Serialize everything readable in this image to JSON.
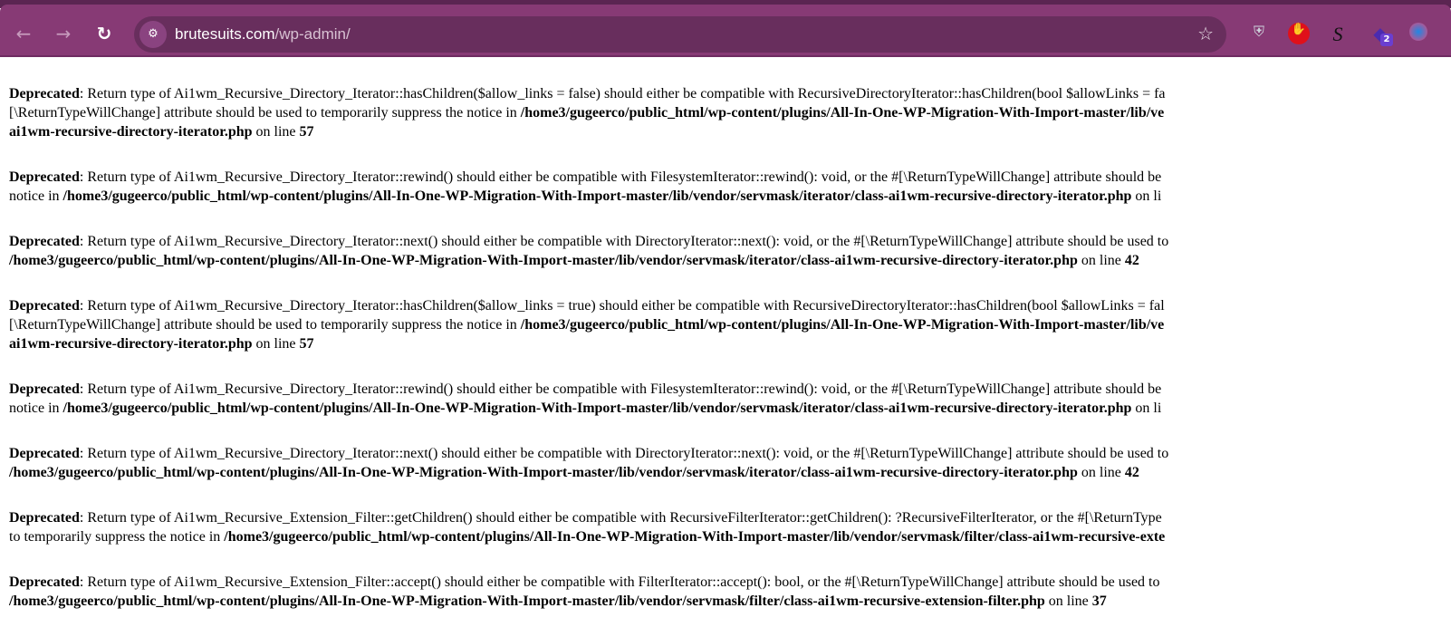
{
  "browser": {
    "url_domain": "brutesuits.com",
    "url_path": "/wp-admin/",
    "extensions": [
      {
        "icon": "shield-extension-icon"
      },
      {
        "icon": "adblock-hand-icon"
      },
      {
        "icon": "s-letter-extension-icon",
        "label": "S"
      },
      {
        "icon": "stack-extension-icon",
        "badge": "2"
      },
      {
        "icon": "browser-extension-icon"
      }
    ]
  },
  "notices": [
    [
      [
        [
          "Deprecated",
          true
        ],
        [
          ": Return type of Ai1wm_Recursive_Directory_Iterator::hasChildren($allow_links = false) should either be compatible with RecursiveDirectoryIterator::hasChildren(bool $allowLinks = fa",
          false
        ]
      ],
      [
        [
          "[\\ReturnTypeWillChange] attribute should be used to temporarily suppress the notice in ",
          false
        ],
        [
          "/home3/gugeerco/public_html/wp-content/plugins/All-In-One-WP-Migration-With-Import-master/lib/ve",
          true
        ]
      ],
      [
        [
          "ai1wm-recursive-directory-iterator.php",
          true
        ],
        [
          " on line ",
          false
        ],
        [
          "57",
          true
        ]
      ]
    ],
    [
      [
        [
          "Deprecated",
          true
        ],
        [
          ": Return type of Ai1wm_Recursive_Directory_Iterator::rewind() should either be compatible with FilesystemIterator::rewind(): void, or the #[\\ReturnTypeWillChange] attribute should be",
          false
        ]
      ],
      [
        [
          "notice in ",
          false
        ],
        [
          "/home3/gugeerco/public_html/wp-content/plugins/All-In-One-WP-Migration-With-Import-master/lib/vendor/servmask/iterator/class-ai1wm-recursive-directory-iterator.php",
          true
        ],
        [
          " on li",
          false
        ]
      ]
    ],
    [
      [
        [
          "Deprecated",
          true
        ],
        [
          ": Return type of Ai1wm_Recursive_Directory_Iterator::next() should either be compatible with DirectoryIterator::next(): void, or the #[\\ReturnTypeWillChange] attribute should be used to",
          false
        ]
      ],
      [
        [
          "/home3/gugeerco/public_html/wp-content/plugins/All-In-One-WP-Migration-With-Import-master/lib/vendor/servmask/iterator/class-ai1wm-recursive-directory-iterator.php",
          true
        ],
        [
          " on line ",
          false
        ],
        [
          "42",
          true
        ]
      ]
    ],
    [
      [
        [
          "Deprecated",
          true
        ],
        [
          ": Return type of Ai1wm_Recursive_Directory_Iterator::hasChildren($allow_links = true) should either be compatible with RecursiveDirectoryIterator::hasChildren(bool $allowLinks = fal",
          false
        ]
      ],
      [
        [
          "[\\ReturnTypeWillChange] attribute should be used to temporarily suppress the notice in ",
          false
        ],
        [
          "/home3/gugeerco/public_html/wp-content/plugins/All-In-One-WP-Migration-With-Import-master/lib/ve",
          true
        ]
      ],
      [
        [
          "ai1wm-recursive-directory-iterator.php",
          true
        ],
        [
          " on line ",
          false
        ],
        [
          "57",
          true
        ]
      ]
    ],
    [
      [
        [
          "Deprecated",
          true
        ],
        [
          ": Return type of Ai1wm_Recursive_Directory_Iterator::rewind() should either be compatible with FilesystemIterator::rewind(): void, or the #[\\ReturnTypeWillChange] attribute should be",
          false
        ]
      ],
      [
        [
          "notice in ",
          false
        ],
        [
          "/home3/gugeerco/public_html/wp-content/plugins/All-In-One-WP-Migration-With-Import-master/lib/vendor/servmask/iterator/class-ai1wm-recursive-directory-iterator.php",
          true
        ],
        [
          " on li",
          false
        ]
      ]
    ],
    [
      [
        [
          "Deprecated",
          true
        ],
        [
          ": Return type of Ai1wm_Recursive_Directory_Iterator::next() should either be compatible with DirectoryIterator::next(): void, or the #[\\ReturnTypeWillChange] attribute should be used to",
          false
        ]
      ],
      [
        [
          "/home3/gugeerco/public_html/wp-content/plugins/All-In-One-WP-Migration-With-Import-master/lib/vendor/servmask/iterator/class-ai1wm-recursive-directory-iterator.php",
          true
        ],
        [
          " on line ",
          false
        ],
        [
          "42",
          true
        ]
      ]
    ],
    [
      [
        [
          "Deprecated",
          true
        ],
        [
          ": Return type of Ai1wm_Recursive_Extension_Filter::getChildren() should either be compatible with RecursiveFilterIterator::getChildren(): ?RecursiveFilterIterator, or the #[\\ReturnType",
          false
        ]
      ],
      [
        [
          "to temporarily suppress the notice in ",
          false
        ],
        [
          "/home3/gugeerco/public_html/wp-content/plugins/All-In-One-WP-Migration-With-Import-master/lib/vendor/servmask/filter/class-ai1wm-recursive-exte",
          true
        ]
      ]
    ],
    [
      [
        [
          "Deprecated",
          true
        ],
        [
          ": Return type of Ai1wm_Recursive_Extension_Filter::accept() should either be compatible with FilterIterator::accept(): bool, or the #[\\ReturnTypeWillChange] attribute should be used to",
          false
        ]
      ],
      [
        [
          "/home3/gugeerco/public_html/wp-content/plugins/All-In-One-WP-Migration-With-Import-master/lib/vendor/servmask/filter/class-ai1wm-recursive-extension-filter.php",
          true
        ],
        [
          " on line ",
          false
        ],
        [
          "37",
          true
        ]
      ]
    ]
  ]
}
